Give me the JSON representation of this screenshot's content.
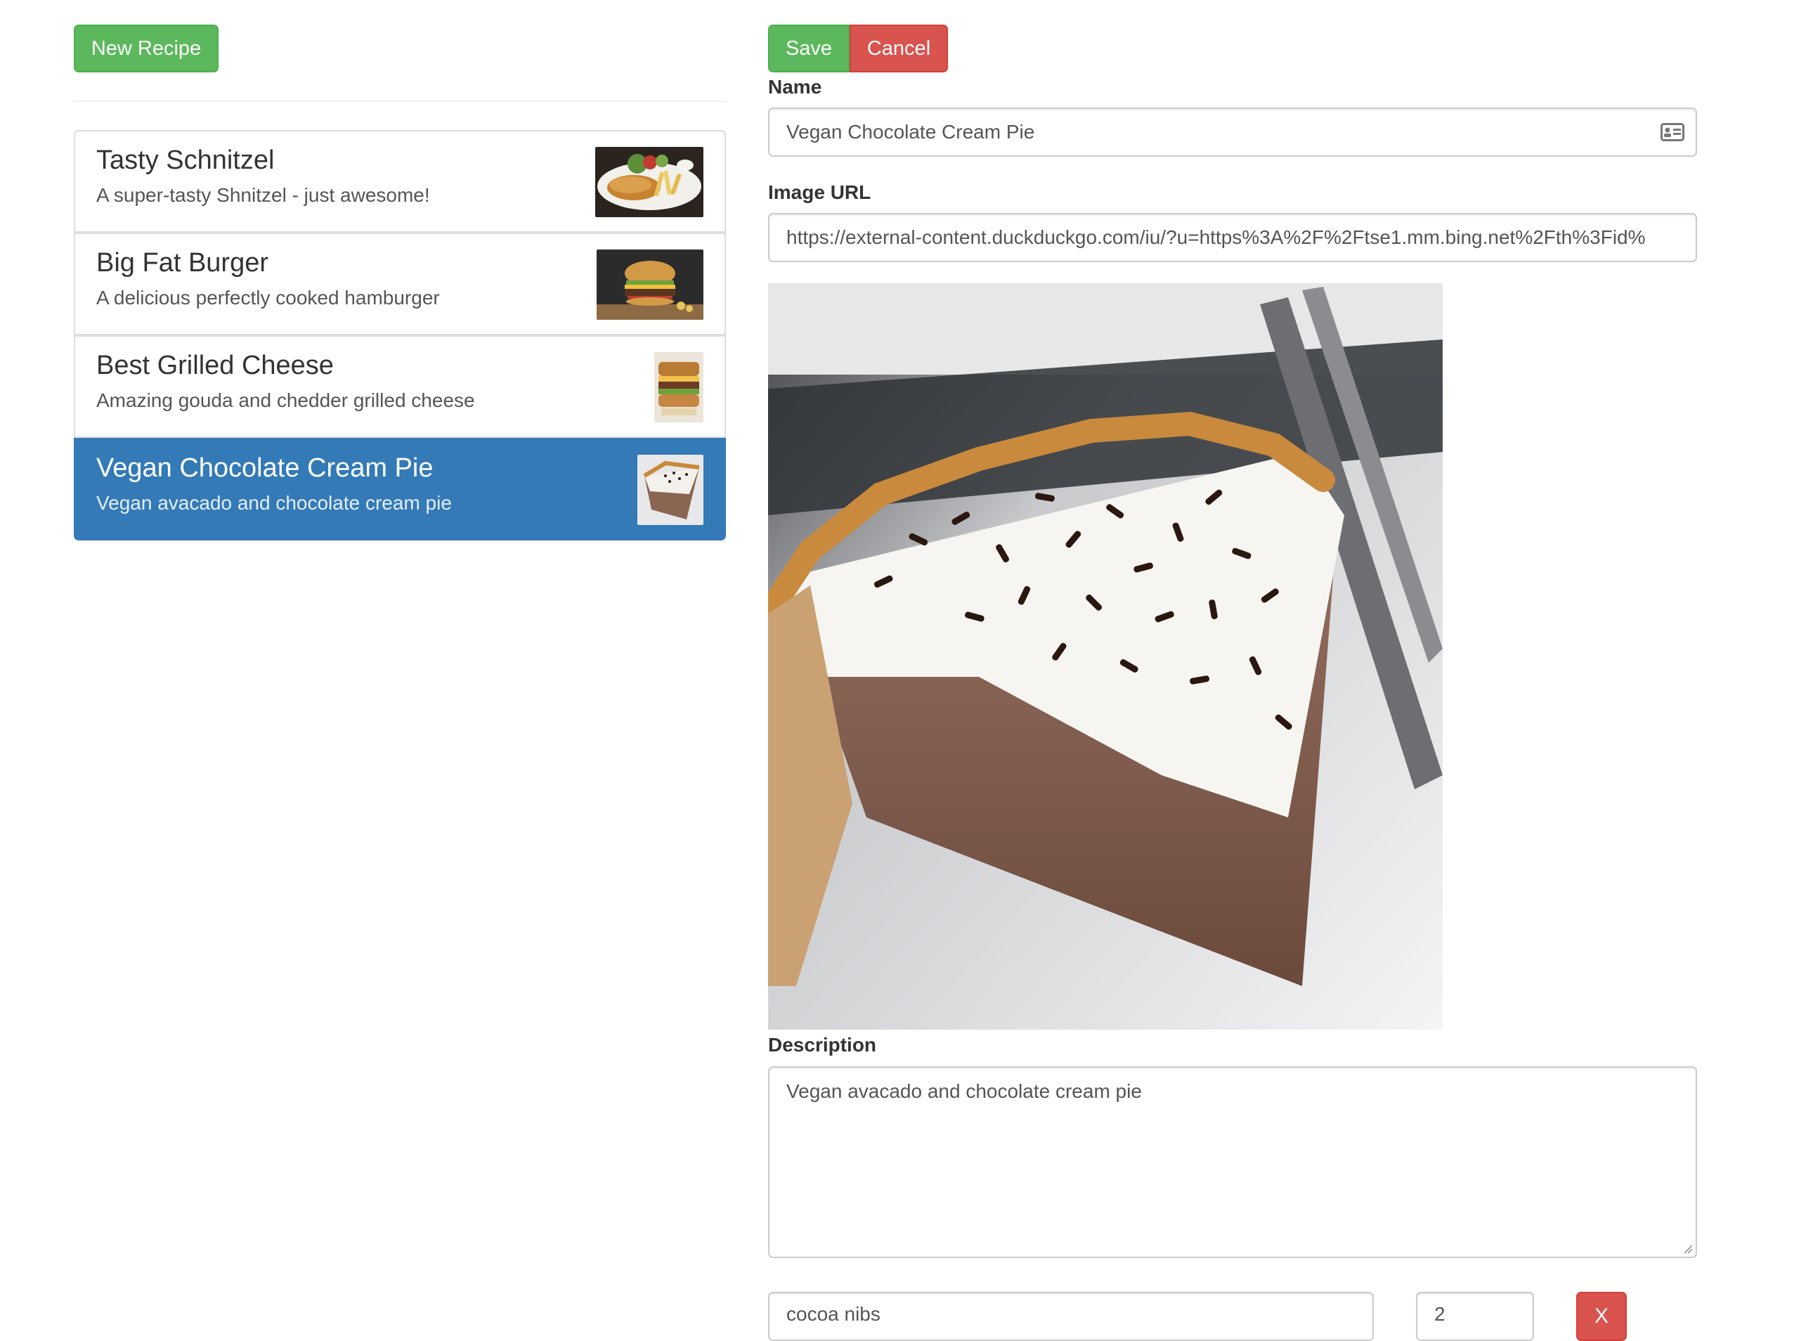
{
  "toolbar": {
    "new_recipe_label": "New Recipe",
    "save_label": "Save",
    "cancel_label": "Cancel"
  },
  "recipes": [
    {
      "title": "Tasty Schnitzel",
      "description": "A super-tasty Shnitzel - just awesome!"
    },
    {
      "title": "Big Fat Burger",
      "description": "A delicious perfectly cooked hamburger"
    },
    {
      "title": "Best Grilled Cheese",
      "description": "Amazing gouda and chedder grilled cheese"
    },
    {
      "title": "Vegan Chocolate Cream Pie",
      "description": "Vegan avacado and chocolate cream pie",
      "active": true
    }
  ],
  "form": {
    "name_label": "Name",
    "name_value": "Vegan Chocolate Cream Pie",
    "image_url_label": "Image URL",
    "image_url_value": "https://external-content.duckduckgo.com/iu/?u=https%3A%2F%2Ftse1.mm.bing.net%2Fth%3Fid%",
    "description_label": "Description",
    "description_value": "Vegan avacado and chocolate cream pie"
  },
  "ingredients": [
    {
      "name": "cocoa nibs",
      "amount": "2",
      "remove_label": "X"
    }
  ],
  "colors": {
    "success": "#5cb85c",
    "danger": "#d9534f",
    "active": "#337ab7"
  },
  "icons": {
    "name_field_icon": "id-card-icon"
  }
}
